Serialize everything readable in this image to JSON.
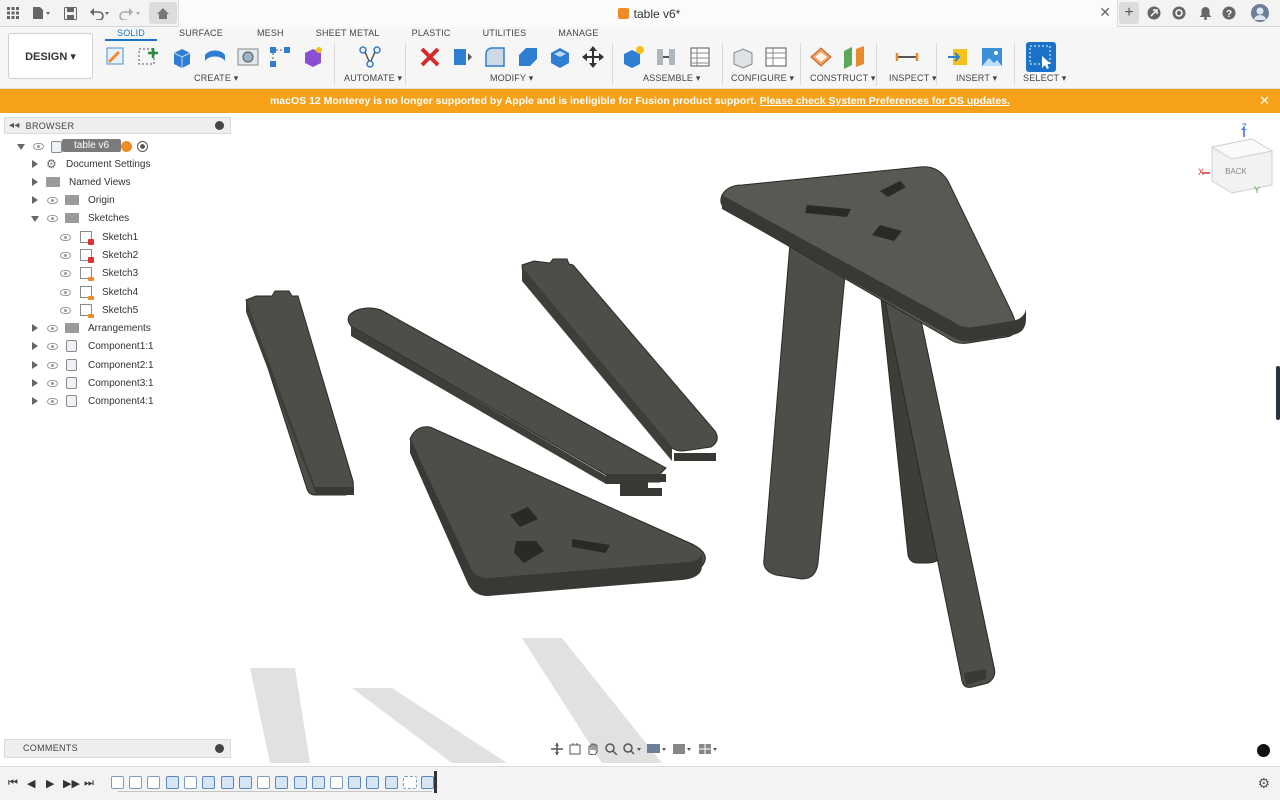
{
  "title_bar": {
    "document_title": "table v6*",
    "icons": [
      "grid-icon",
      "file-icon",
      "save-icon",
      "undo-icon",
      "redo-icon",
      "home-icon",
      "new-tab-icon",
      "extensions-icon",
      "job-status-icon",
      "notifications-icon",
      "help-icon",
      "user-avatar-icon"
    ]
  },
  "toolbar": {
    "workspace_button": "DESIGN ▾",
    "tabs": [
      "SOLID",
      "SURFACE",
      "MESH",
      "SHEET METAL",
      "PLASTIC",
      "UTILITIES",
      "MANAGE"
    ],
    "active_tab": "SOLID",
    "groups": [
      "CREATE ▾",
      "AUTOMATE ▾",
      "MODIFY ▾",
      "ASSEMBLE ▾",
      "CONFIGURE ▾",
      "CONSTRUCT ▾",
      "INSPECT ▾",
      "INSERT ▾",
      "SELECT ▾"
    ]
  },
  "banner": {
    "message": "macOS 12 Monterey is no longer supported by Apple and is ineligible for Fusion product support.",
    "link": "Please check System Preferences for OS updates.",
    "color": "#f7a11a"
  },
  "browser": {
    "header": "BROWSER",
    "root": "table v6",
    "items": [
      {
        "label": "Document Settings"
      },
      {
        "label": "Named Views"
      },
      {
        "label": "Origin"
      },
      {
        "label": "Sketches"
      },
      {
        "label": "Sketch1"
      },
      {
        "label": "Sketch2"
      },
      {
        "label": "Sketch3"
      },
      {
        "label": "Sketch4"
      },
      {
        "label": "Sketch5"
      },
      {
        "label": "Arrangements"
      },
      {
        "label": "Component1:1"
      },
      {
        "label": "Component2:1"
      },
      {
        "label": "Component3:1"
      },
      {
        "label": "Component4:1"
      }
    ]
  },
  "viewcube": {
    "face": "BACK",
    "axes": [
      "Z",
      "X",
      "Y"
    ]
  },
  "comments": {
    "label": "COMMENTS"
  },
  "timeline": {
    "controls": [
      "⏮",
      "◀",
      "▶",
      "▶▶",
      "⏭"
    ]
  },
  "colors": {
    "accent": "#1a73c8",
    "banner": "#f7a11a",
    "model": "#4f4d47",
    "model_edge": "#2a2926"
  }
}
